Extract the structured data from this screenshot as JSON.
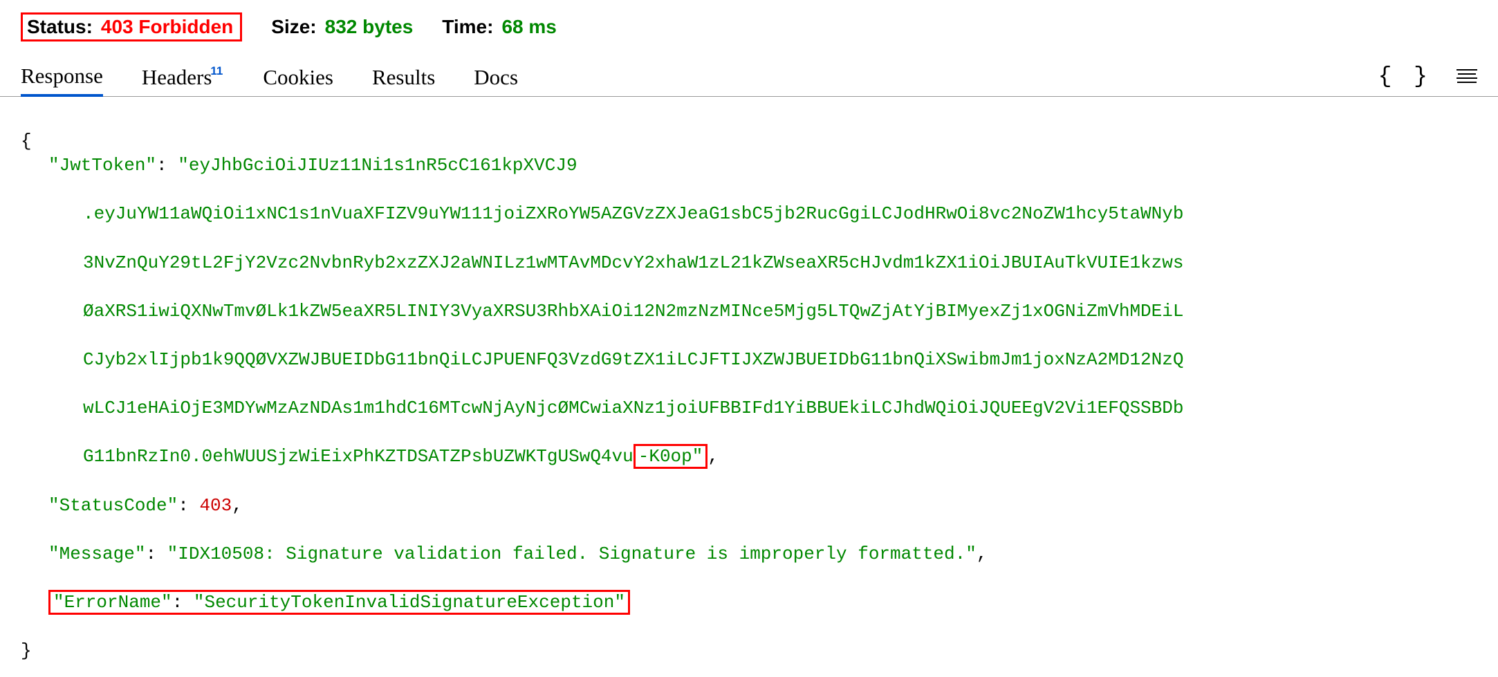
{
  "statusBar": {
    "statusLabel": "Status:",
    "statusValue": "403 Forbidden",
    "sizeLabel": "Size:",
    "sizeValue": "832 bytes",
    "timeLabel": "Time:",
    "timeValue": "68 ms"
  },
  "tabs": {
    "response": "Response",
    "headers": "Headers",
    "headersBadge": "11",
    "cookies": "Cookies",
    "results": "Results",
    "docs": "Docs"
  },
  "json": {
    "openBrace": "{",
    "closeBrace": "}",
    "jwtKey": "\"JwtToken\"",
    "jwtPart1": "\"eyJhbGciOiJIUz11Ni1s1nR5cC161kpXVCJ9",
    "jwtLine2": ".eyJuYW11aWQiOi1xNC1s1nVuaXFIZV9uYW111joiZXRoYW5AZGVzZXJeaG1sbC5jb2RucGgiLCJodHRwOi8vc2NoZW1hcy5taWNyb",
    "jwtLine3": "3NvZnQuY29tL2FjY2Vzc2NvbnRyb2xzZXJ2aWNILz1wMTAvMDcvY2xhaW1zL21kZWseaXR5cHJvdm1kZX1iOiJBUIAuTkVUIE1kzws",
    "jwtLine4": "ØaXRS1iwiQXNwTmvØLk1kZW5eaXR5LINIY3VyaXRSU3RhbXAiOi12N2mzNzMINce5Mjg5LTQwZjAtYjBIMyexZj1xOGNiZmVhMDEiL",
    "jwtLine5": "CJyb2xlIjpb1k9QQØVXZWJBUEIDbG11bnQiLCJPUENFQ3VzdG9tZX1iLCJFTIJXZWJBUEIDbG11bnQiXSwibmJm1joxNzA2MD12NzQ",
    "jwtLine6": "wLCJ1eHAiOjE3MDYwMzAzNDAs1m1hdC16MTcwNjAyNjcØMCwiaXNz1joiUFBBIFd1YiBBUEkiLCJhdWQiOiJQUEEgV2Vi1EFQSSBDb",
    "jwtLine7Main": "G11bnRzIn0.0ehWUUSjzWiEixPhKZTDSATZPsbUZWKTgUSwQ4vu",
    "jwtLine7Highlight": "-K0op\"",
    "statusCodeKey": "\"StatusCode\"",
    "statusCodeVal": "403",
    "messageKey": "\"Message\"",
    "messageVal": "\"IDX10508: Signature validation failed. Signature is improperly formatted.\"",
    "errorNameKey": "\"ErrorName\"",
    "errorNameVal": "\"SecurityTokenInvalidSignatureException\"",
    "colon": ": ",
    "comma": ","
  }
}
